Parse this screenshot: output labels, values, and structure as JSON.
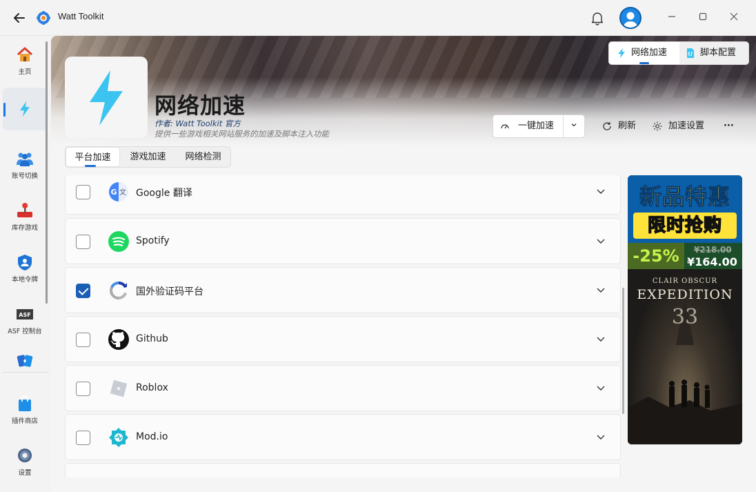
{
  "window": {
    "title": "Watt Toolkit"
  },
  "nav": {
    "items": [
      {
        "label": "主页",
        "icon": "home-icon"
      },
      {
        "label": "",
        "icon": "lightning-icon"
      },
      {
        "label": "账号切换",
        "icon": "users-icon"
      },
      {
        "label": "库存游戏",
        "icon": "joystick-icon"
      },
      {
        "label": "本地令牌",
        "icon": "shield-user-icon"
      },
      {
        "label": "ASF 控制台",
        "icon": "asf-icon"
      },
      {
        "label": "",
        "icon": "cards-icon"
      },
      {
        "label": "插件商店",
        "icon": "shopping-bag-icon"
      },
      {
        "label": "设置",
        "icon": "gear-icon"
      }
    ],
    "active_index": 1
  },
  "switcher": {
    "network_accel": "网络加速",
    "script_config": "脚本配置"
  },
  "hero": {
    "title": "网络加速",
    "author": "作者:  Watt Toolkit  官方",
    "description": "提供一些游戏相关网站服务的加速及脚本注入功能"
  },
  "toolbar": {
    "one_click": "一键加速",
    "refresh": "刷新",
    "settings": "加速设置",
    "more": "···"
  },
  "tabs": [
    {
      "label": "平台加速",
      "active": true
    },
    {
      "label": "游戏加速",
      "active": false
    },
    {
      "label": "网络检测",
      "active": false
    }
  ],
  "services": [
    {
      "name": "Google 翻译",
      "checked": false,
      "icon": "google-translate-icon"
    },
    {
      "name": "Spotify",
      "checked": false,
      "icon": "spotify-icon"
    },
    {
      "name": "国外验证码平台",
      "checked": true,
      "icon": "recaptcha-icon"
    },
    {
      "name": "Github",
      "checked": false,
      "icon": "github-icon"
    },
    {
      "name": "Roblox",
      "checked": false,
      "icon": "roblox-icon"
    },
    {
      "name": "Mod.io",
      "checked": false,
      "icon": "modio-icon"
    }
  ],
  "ad": {
    "headline1": "新品特惠",
    "headline2": "限时抢购",
    "discount": "-25%",
    "original_price": "¥218.00",
    "price": "¥164.00",
    "game_subtitle": "CLAIR OBSCUR",
    "game_title": "EXPEDITION",
    "game_number": "33"
  },
  "colors": {
    "accent": "#1a6fd1",
    "lightning": "#3cc4f0",
    "checked": "#1b5fb5",
    "ad_yellow": "#ffe23a",
    "ad_green": "#c6f14b"
  }
}
